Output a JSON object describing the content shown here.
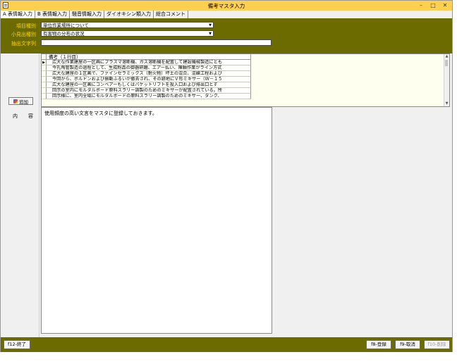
{
  "window": {
    "title": "備考マスタ入力"
  },
  "title_buttons": {
    "minimize": "–",
    "maximize": "□",
    "close": "✕"
  },
  "tabs": [
    {
      "label": "A 表情報入力"
    },
    {
      "label": "B 表情報入力"
    },
    {
      "label": "騒音情報入力"
    },
    {
      "label": "ダイオキシン類入力"
    },
    {
      "label": "総合コメント"
    }
  ],
  "form": {
    "item_type": {
      "label": "項目種別",
      "value": "単位作業場所について"
    },
    "sub_type": {
      "label": "小見出種別",
      "value": "有害物の分布の状況"
    },
    "extract": {
      "label": "抽出文字列",
      "value": ""
    }
  },
  "grid": {
    "column_header": "備考（１行目）",
    "current_marker": "▶",
    "rows": [
      "広大な作業建屋の一区画にプラズマ溶断機、ガス溶断機を配置して建設機械製造にとも",
      "今孔陶管製造の過程として、生成粉品の御器研磨、エアー払い、陳軸作業がライン方式",
      "広大な建屋の１区画で、ファインセラミックス（耐火物）坏土の混合、混練工程および",
      "今回から、ボルドンおよび振動ふるいが撤去され、その跡地にＶ形ミキサー（Ｗ－１５",
      "広大な建屋の一区画にコンベアーもしくはバケットリフトを投入口および排出口とす",
      "回示の室内にモルタルボード原料スラリー調製のためのミキサーが配置されている。所",
      "回示様に、室内全域にモルタルボードの原料スラリー調製のためのミキサー、タンク、"
    ]
  },
  "add_button": {
    "label": "追加"
  },
  "content": {
    "label": "内　容",
    "text": "使用頻度の高い文言をマスタに登録しておきます。"
  },
  "footer": {
    "f12": "f12-終了",
    "f8": "f8-登録",
    "f9": "f9-取消",
    "f10": "f10-削除"
  }
}
